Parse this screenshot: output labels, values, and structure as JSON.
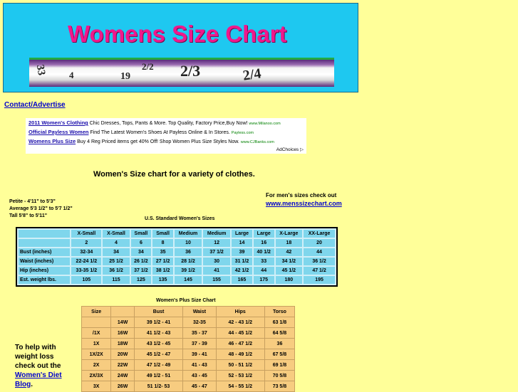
{
  "banner": {
    "title": "Womens Size Chart",
    "tape_numbers": [
      "33",
      "4",
      "19",
      "2/2",
      "2/3",
      "2/4"
    ]
  },
  "nav": {
    "contact_label": "Contact/Advertise"
  },
  "ads": [
    {
      "title": "2011 Women's Clothing",
      "text": "Chic Dresses, Tops, Pants & More. Top Quality, Factory Price,Buy Now!",
      "source": "www.Milanoo.com"
    },
    {
      "title": "Official Payless Women",
      "text": "Find The Latest Women's Shoes At Payless Online & In Stores.",
      "source": "Payless.com"
    },
    {
      "title": "Womens Plus Size",
      "text": "Buy 4 Reg Priced items get 40% Off! Shop Women Plus Size Styles Now.",
      "source": "www.CJBanks.com"
    }
  ],
  "ad_choices": "AdChoices",
  "headline": "Women's Size chart for a variety of clothes.",
  "mens": {
    "label": "For men's sizes check out",
    "link": "www.menssizechart.com"
  },
  "size_ranges": [
    "Petite - 4'11\" to 5'3\"",
    "Average 5'3 1/2\" to 5'7 1/2\"",
    "Tall 5'8\" to 5'11\""
  ],
  "us_chart": {
    "title": "U.S. Standard Women's Sizes",
    "headers": [
      "",
      "X-Small",
      "X-Small",
      "Small",
      "Small",
      "Medium",
      "Medium",
      "Large",
      "Large",
      "X-Large",
      "XX-Large"
    ],
    "rows": [
      [
        "",
        "2",
        "4",
        "6",
        "8",
        "10",
        "12",
        "14",
        "16",
        "18",
        "20"
      ],
      [
        "Bust (inches)",
        "32-34",
        "34",
        "34",
        "35",
        "36",
        "37 1/2",
        "39",
        "40 1/2",
        "42",
        "44"
      ],
      [
        "Waist (inches)",
        "22-24 1/2",
        "25 1/2",
        "26 1/2",
        "27 1/2",
        "28 1/2",
        "30",
        "31 1/2",
        "33",
        "34 1/2",
        "36 1/2"
      ],
      [
        "Hip (inches)",
        "33-35 1/2",
        "36 1/2",
        "37 1/2",
        "38 1/2",
        "39 1/2",
        "41",
        "42 1/2",
        "44",
        "45 1/2",
        "47 1/2"
      ],
      [
        "Est. weight lbs.",
        "105",
        "115",
        "125",
        "135",
        "145",
        "155",
        "165",
        "175",
        "180",
        "195"
      ]
    ]
  },
  "plus_chart": {
    "title": "Women's Plus Size Chart",
    "headers": [
      "Size",
      "",
      "Bust",
      "Waist",
      "Hips",
      "Torso"
    ],
    "rows": [
      [
        "",
        "14W",
        "39 1/2 - 41",
        "32-35",
        "42 - 43 1/2",
        "63 1/8"
      ],
      [
        "/1X",
        "16W",
        "41 1/2 - 43",
        "35 - 37",
        "44 - 45 1/2",
        "64 5/8"
      ],
      [
        "1X",
        "18W",
        "43 1/2 - 45",
        "37 - 39",
        "46 - 47 1/2",
        "36"
      ],
      [
        "1X/2X",
        "20W",
        "45 1/2 - 47",
        "39 - 41",
        "48 - 49 1/2",
        "67 5/8"
      ],
      [
        "2X",
        "22W",
        "47 1/2 - 49",
        "41 - 43",
        "50 - 51 1/2",
        "69 1/8"
      ],
      [
        "2X/3X",
        "24W",
        "49 1/2 - 51",
        "43 - 45",
        "52 - 53 1/2",
        "70 5/8"
      ],
      [
        "3X",
        "26W",
        "51 1/2- 53",
        "45 - 47",
        "54 - 55 1/2",
        "73 5/8"
      ]
    ]
  },
  "diet": {
    "lines": [
      "To help with",
      "weight loss",
      "check out the"
    ],
    "link_1": "Women's Diet",
    "link_2": "Blog",
    "tail": "."
  }
}
